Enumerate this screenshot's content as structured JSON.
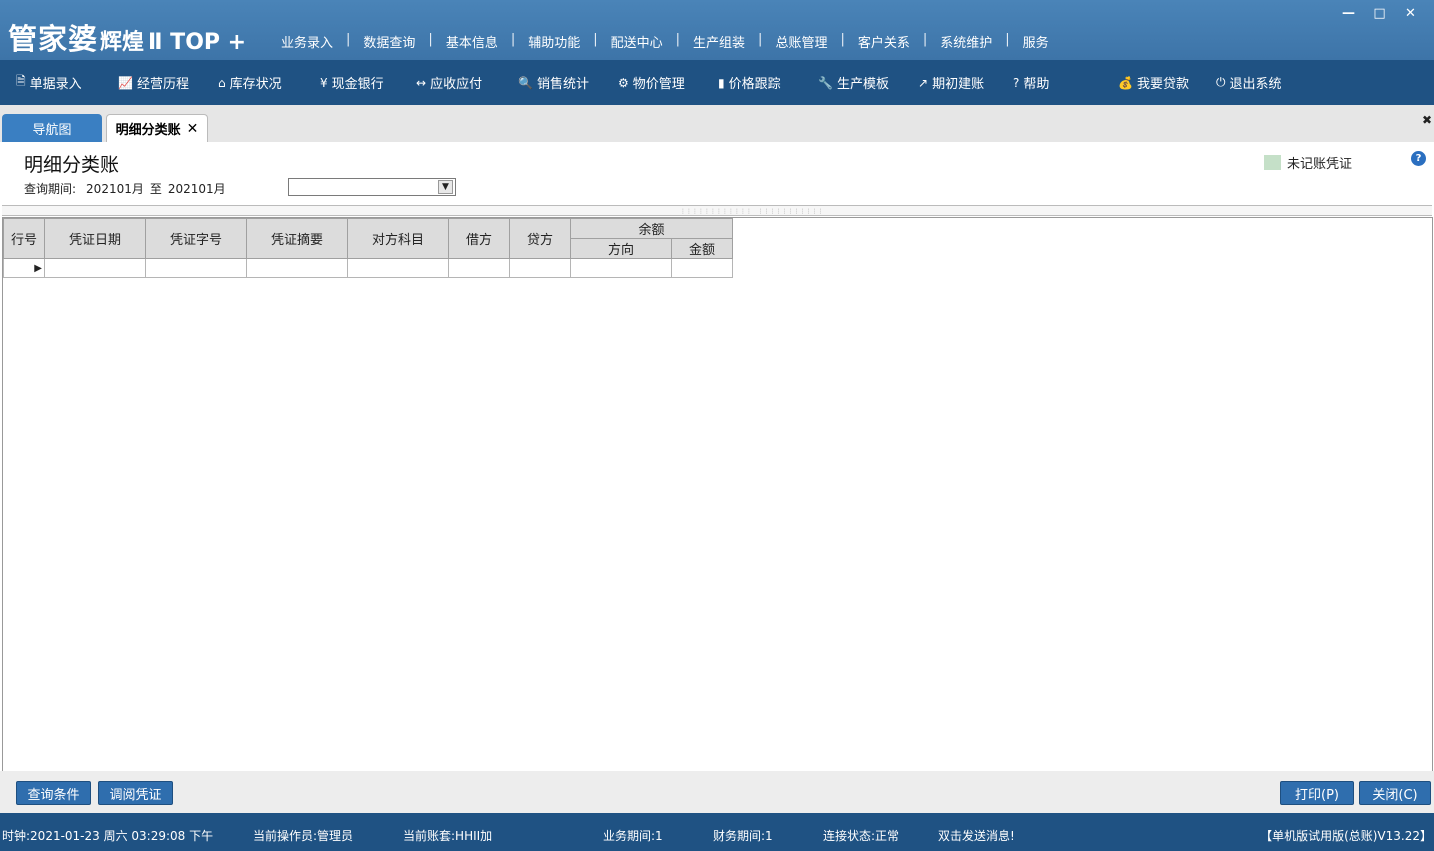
{
  "app": {
    "logo_main": "管家婆",
    "logo_sub": "辉煌",
    "logo_ver": "Ⅱ TOP +"
  },
  "top_menu": [
    "业务录入",
    "数据查询",
    "基本信息",
    "辅助功能",
    "配送中心",
    "生产组装",
    "总账管理",
    "客户关系",
    "系统维护",
    "服务"
  ],
  "toolbar": [
    {
      "icon": "doc-icon",
      "glyph": "🗎",
      "label": "单据录入"
    },
    {
      "icon": "chart-line-icon",
      "glyph": "📈",
      "label": "经营历程"
    },
    {
      "icon": "home-icon",
      "glyph": "⌂",
      "label": "库存状况"
    },
    {
      "icon": "yen-icon",
      "glyph": "¥",
      "label": "现金银行"
    },
    {
      "icon": "arrows-icon",
      "glyph": "↔",
      "label": "应收应付"
    },
    {
      "icon": "search-icon",
      "glyph": "🔍",
      "label": "销售统计"
    },
    {
      "icon": "gear-icon",
      "glyph": "⚙",
      "label": "物价管理"
    },
    {
      "icon": "bar-chart-icon",
      "glyph": "▮",
      "label": "价格跟踪"
    },
    {
      "icon": "wrench-icon",
      "glyph": "🔧",
      "label": "生产模板"
    },
    {
      "icon": "external-link-icon",
      "glyph": "↗",
      "label": "期初建账"
    },
    {
      "icon": "question-icon",
      "glyph": "?",
      "label": "帮助"
    },
    {
      "icon": "money-bag-icon",
      "glyph": "💰",
      "label": "我要贷款"
    },
    {
      "icon": "power-icon",
      "glyph": "⏻",
      "label": "退出系统"
    }
  ],
  "tabs": {
    "nav": "导航图",
    "active": "明细分类账",
    "close_glyph": "✕"
  },
  "page": {
    "title": "明细分类账",
    "period_label": "查询期间:",
    "period_from": "202101月",
    "period_to_word": "至",
    "period_to": "202101月",
    "combo_value": "",
    "legend_label": "未记账凭证",
    "legend_color": "#c5e0c8"
  },
  "grid": {
    "headers": [
      "行号",
      "凭证日期",
      "凭证字号",
      "凭证摘要",
      "对方科目",
      "借方",
      "贷方"
    ],
    "balance_group": "余额",
    "balance_sub": [
      "方向",
      "金额"
    ],
    "rows": [
      [
        "",
        "",
        "",
        "",
        "",
        "",
        "",
        "",
        ""
      ]
    ]
  },
  "buttons": {
    "query": "查询条件",
    "view_voucher": "调阅凭证",
    "print": "打印(P)",
    "close": "关闭(C)"
  },
  "status": {
    "clock": "时钟:2021-01-23 周六 03:29:08 下午",
    "operator": "当前操作员:管理员",
    "account": "当前账套:HHII加",
    "biz_period": "业务期间:1",
    "fin_period": "财务期间:1",
    "connection": "连接状态:正常",
    "message": "双击发送消息!",
    "version": "【单机版试用版(总账)V13.22】"
  },
  "colors": {
    "title_bar": "#4a84b8",
    "toolbar": "#1f5283",
    "button": "#2f6eae"
  }
}
